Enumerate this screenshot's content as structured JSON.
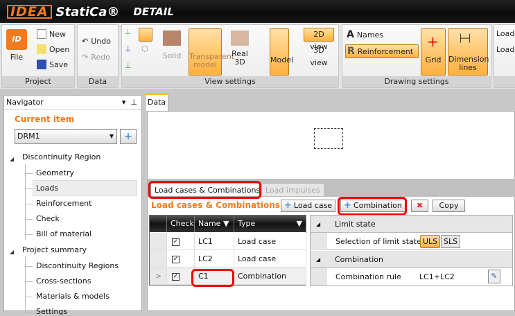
{
  "app": {
    "brand": "IDEA",
    "brand2": "StatiCa®",
    "product": "DETAIL"
  },
  "ribbon": {
    "project": {
      "label": "Project",
      "file": "File",
      "new": "New",
      "open": "Open",
      "save": "Save"
    },
    "data": {
      "label": "Data",
      "undo": "Undo",
      "redo": "Redo"
    },
    "view": {
      "label": "View settings",
      "solid": "Solid",
      "transparent": "Transparent model",
      "real3d": "Real 3D",
      "model": "Model",
      "view2d": "2D view",
      "view3d": "3D view"
    },
    "drawing": {
      "label": "Drawing settings",
      "names": "Names",
      "reinforcement": "Reinforcement",
      "grid": "Grid",
      "dimension": "Dimension lines"
    },
    "load": {
      "item1": "Load",
      "item2": "Load"
    }
  },
  "navigator": {
    "title": "Navigator",
    "current_item_label": "Current item",
    "current_item": "DRM1",
    "groups": [
      {
        "label": "Discontinuity Region",
        "items": [
          "Geometry",
          "Loads",
          "Reinforcement",
          "Check",
          "Bill of material"
        ]
      },
      {
        "label": "Project summary",
        "items": [
          "Discontinuity Regions",
          "Cross-sections",
          "Materials & models",
          "Settings"
        ]
      }
    ]
  },
  "main": {
    "tab": "Data",
    "subtabs": [
      "Load cases & Combinations",
      "Load impulses"
    ],
    "heading": "Load cases & Combinations",
    "buttons": {
      "load_case": "Load case",
      "combination": "Combination",
      "copy": "Copy"
    },
    "grid": {
      "columns": [
        "Check",
        "Name",
        "Type"
      ],
      "rows": [
        {
          "check": true,
          "name": "LC1",
          "type": "Load case"
        },
        {
          "check": true,
          "name": "LC2",
          "type": "Load case"
        },
        {
          "check": true,
          "name": "C1",
          "type": "Combination",
          "selected": true
        }
      ]
    },
    "props": {
      "limit_state_header": "Limit state",
      "limit_state_label": "Selection of limit state",
      "uls": "ULS",
      "sls": "SLS",
      "combination_header": "Combination",
      "rule_label": "Combination rule",
      "rule_value": "LC1+LC2"
    }
  }
}
